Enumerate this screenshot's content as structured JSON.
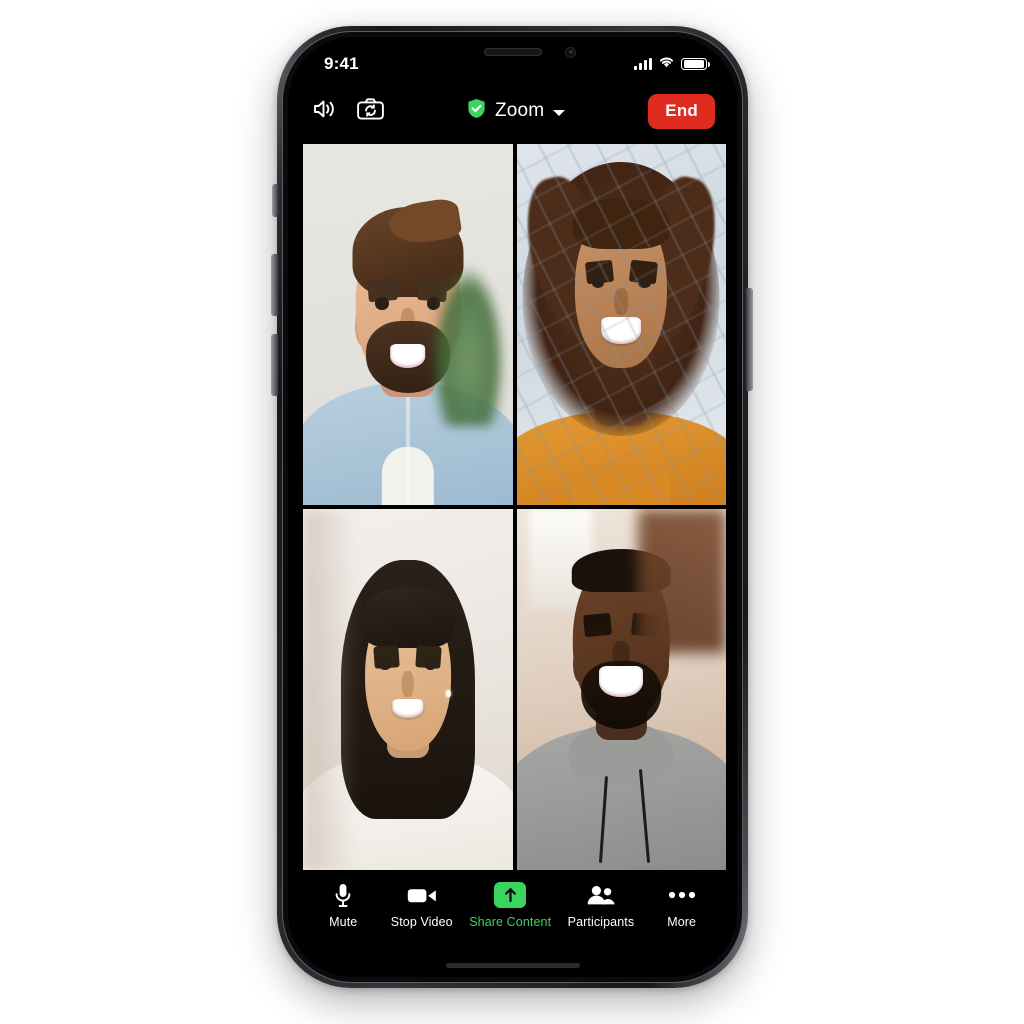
{
  "device": {
    "name": "iphone-12-pro"
  },
  "status_bar": {
    "time": "9:41",
    "icons": [
      "cellular-signal-icon",
      "wifi-icon",
      "battery-icon"
    ],
    "battery_level": 100
  },
  "nav_bar": {
    "speaker_icon": "speaker-wave-icon",
    "flip_camera_icon": "camera-flip-icon",
    "shield_icon": "shield-check-icon",
    "title": "Zoom",
    "chevron_icon": "chevron-down-icon",
    "end_label": "End",
    "end_color": "#e02b20",
    "accent_color": "#3ad45f"
  },
  "grid": {
    "active_border_color": "#3ad45f",
    "tiles": [
      {
        "id": "tile-1",
        "active": true,
        "scene": "man-denim-shirt"
      },
      {
        "id": "tile-2",
        "active": false,
        "scene": "woman-curly-hair-mustard"
      },
      {
        "id": "tile-3",
        "active": false,
        "scene": "woman-dark-hair-white-tee"
      },
      {
        "id": "tile-4",
        "active": false,
        "scene": "man-grey-hoodie"
      }
    ]
  },
  "toolbar": {
    "items": [
      {
        "label": "Mute",
        "icon": "microphone-icon",
        "accent": false
      },
      {
        "label": "Stop Video",
        "icon": "video-camera-icon",
        "accent": false
      },
      {
        "label": "Share Content",
        "icon": "share-arrow-up-icon",
        "accent": true
      },
      {
        "label": "Participants",
        "icon": "participants-icon",
        "accent": false
      },
      {
        "label": "More",
        "icon": "ellipsis-icon",
        "accent": false
      }
    ]
  }
}
